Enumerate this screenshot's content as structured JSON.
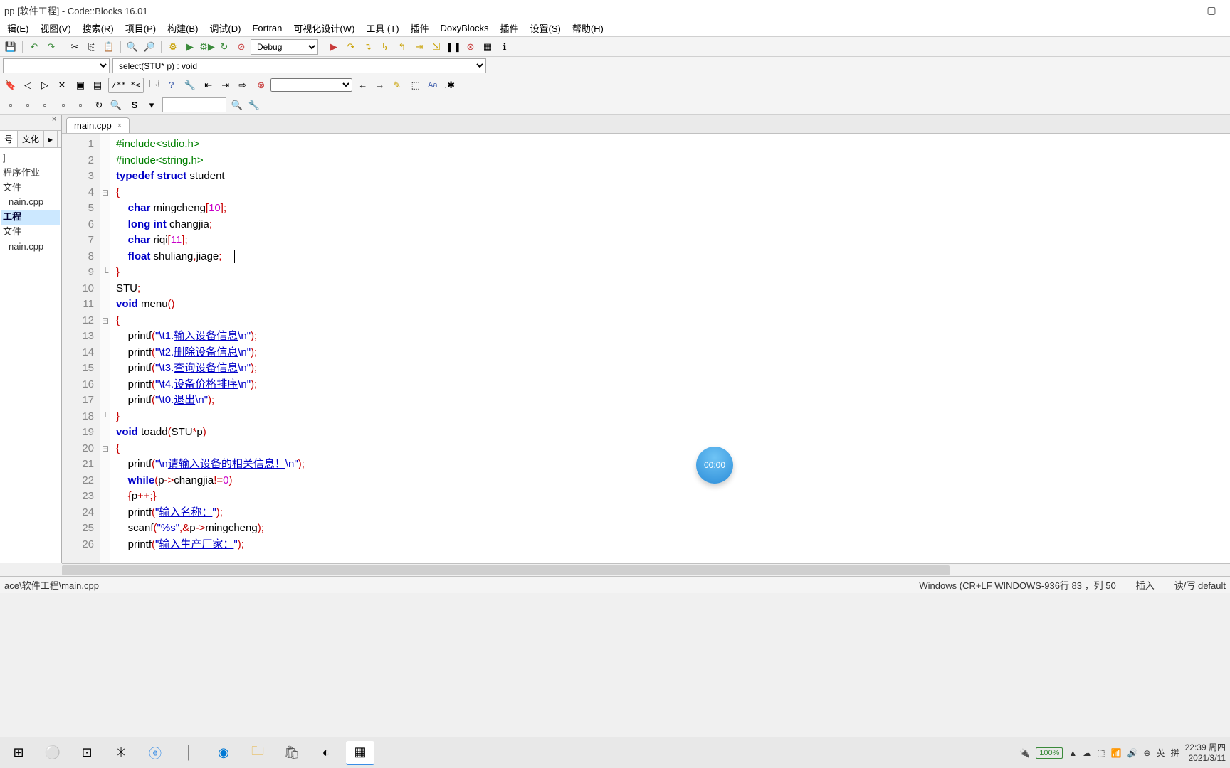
{
  "title": "pp [软件工程] - Code::Blocks 16.01",
  "menus": [
    "辑(E)",
    "视图(V)",
    "搜索(R)",
    "项目(P)",
    "构建(B)",
    "调试(D)",
    "Fortran",
    "可视化设计(W)",
    "工具 (T)",
    "插件",
    "DoxyBlocks",
    "插件",
    "设置(S)",
    "帮助(H)"
  ],
  "debug_select": "Debug",
  "scope_select": "select(STU* p) : void",
  "comment_btn": "/** *<",
  "sidebar": {
    "tabs": [
      "号",
      "文化",
      "▸"
    ],
    "items": [
      {
        "label": "]",
        "indent": 0,
        "sel": false
      },
      {
        "label": "程序作业",
        "indent": 0,
        "sel": false
      },
      {
        "label": "文件",
        "indent": 0,
        "sel": false
      },
      {
        "label": "nain.cpp",
        "indent": 1,
        "sel": false
      },
      {
        "label": "工程",
        "indent": 0,
        "sel": true
      },
      {
        "label": "文件",
        "indent": 0,
        "sel": false
      },
      {
        "label": "nain.cpp",
        "indent": 1,
        "sel": false
      }
    ]
  },
  "filetab": {
    "name": "main.cpp",
    "close": "×"
  },
  "code": {
    "lines": [
      1,
      2,
      3,
      4,
      5,
      6,
      7,
      8,
      9,
      10,
      11,
      12,
      13,
      14,
      15,
      16,
      17,
      18,
      19,
      20,
      21,
      22,
      23,
      24,
      25,
      26
    ],
    "fold": [
      "",
      "",
      "",
      "⊟",
      "",
      "",
      "",
      "",
      "└",
      "",
      "",
      "⊟",
      "",
      "",
      "",
      "",
      "",
      "└",
      "",
      "⊟",
      "",
      "",
      "",
      "",
      "",
      ""
    ]
  },
  "recorder": "00:00",
  "status": {
    "path": "ace\\软件工程\\main.cpp",
    "encoding": "Windows (CR+LF WINDOWS-936行 83 ，列 50",
    "insert": "插入",
    "rw": "读/写 default"
  },
  "tray": {
    "battery": "100%",
    "icons": [
      "▲",
      "☁",
      "⬚",
      "📶",
      "🔊",
      "⊕"
    ],
    "ime": [
      "英",
      "拼"
    ],
    "time": "22:39 周四",
    "date": "2021/3/11"
  }
}
